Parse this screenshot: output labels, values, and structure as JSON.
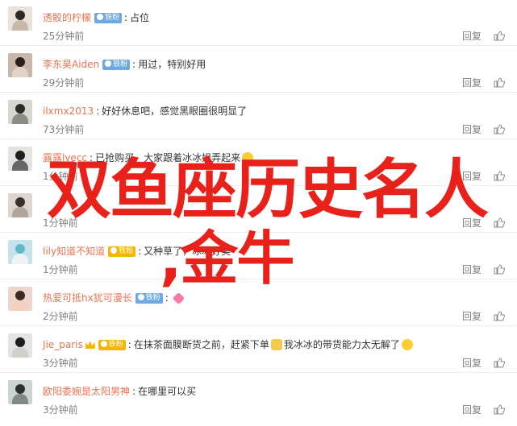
{
  "comments": [
    {
      "user": "透骰的柠檬",
      "badge": "vip",
      "text": "占位",
      "emoji": "",
      "time": "25分钟前",
      "avatar_bg": "#e9e2dc",
      "avatar_head": "#2d2a2a",
      "avatar_body": "#c9b8a7"
    },
    {
      "user": "李东昊Aiden",
      "badge": "vip",
      "text": "用过，特别好用",
      "emoji": "",
      "time": "29分钟前",
      "avatar_bg": "#c9b7a9",
      "avatar_head": "#2a1f1c",
      "avatar_body": "#e0d2c6"
    },
    {
      "user": "ilxmx2013",
      "badge": "",
      "text": "好好休息吧，感觉黑眼圈很明显了",
      "emoji": "",
      "time": "73分钟前",
      "avatar_bg": "#d6d7cf",
      "avatar_head": "#2c2b2b",
      "avatar_body": "#8c8c86"
    },
    {
      "user": "露露lvecc",
      "badge": "",
      "text": "已抢购买，大家跟着冰冰姐弄起来",
      "emoji": "smile",
      "time": "1分钟前",
      "avatar_bg": "#e5e3df",
      "avatar_head": "#1f1f1f",
      "avatar_body": "#666666"
    },
    {
      "user": "",
      "badge": "",
      "text": "",
      "emoji": "",
      "time": "1分钟前",
      "avatar_bg": "#dcd6d0",
      "avatar_head": "#3a2f2a",
      "avatar_body": "#b2a59c"
    },
    {
      "user": "lily知道不知道",
      "badge": "gold",
      "text": "又种草了，冰冰好美",
      "emoji": "",
      "time": "1分钟前",
      "avatar_bg": "#c4e3ea",
      "avatar_head": "#5fb9c9",
      "avatar_body": "#f0f3f5"
    },
    {
      "user": "热爱可抵hx犹可漫长",
      "badge": "vip",
      "text": "",
      "emoji": "pink",
      "time": "2分钟前",
      "avatar_bg": "#ecd6cc",
      "avatar_head": "#3b2a24",
      "avatar_body": "#f3d0c1"
    },
    {
      "user": "Jie_paris",
      "badge": "gold",
      "text": "在抹茶面膜断货之前，赶紧下单",
      "text2": "我冰冰的带货能力太无解了",
      "emoji": "cat",
      "time": "3分钟前",
      "avatar_bg": "#e4e3e1",
      "avatar_head": "#1e1e1e",
      "avatar_body": "#d0cfcb"
    },
    {
      "user": "欧阳委婉是太阳男神",
      "badge": "",
      "text": "在哪里可以买",
      "emoji": "",
      "time": "3分钟前",
      "avatar_bg": "#cdd4cf",
      "avatar_head": "#2b2f2d",
      "avatar_body": "#7f8a84"
    }
  ],
  "labels": {
    "reply": "回复",
    "vip": "V",
    "fan": "铁粉"
  },
  "overlay": {
    "line1": "双鱼座历史名人",
    "line2": ",金牛"
  },
  "colors": {
    "username": "#eb7350",
    "overlay": "#e8211b",
    "vip": "#6ea9e0",
    "gold": "#f7b500"
  }
}
